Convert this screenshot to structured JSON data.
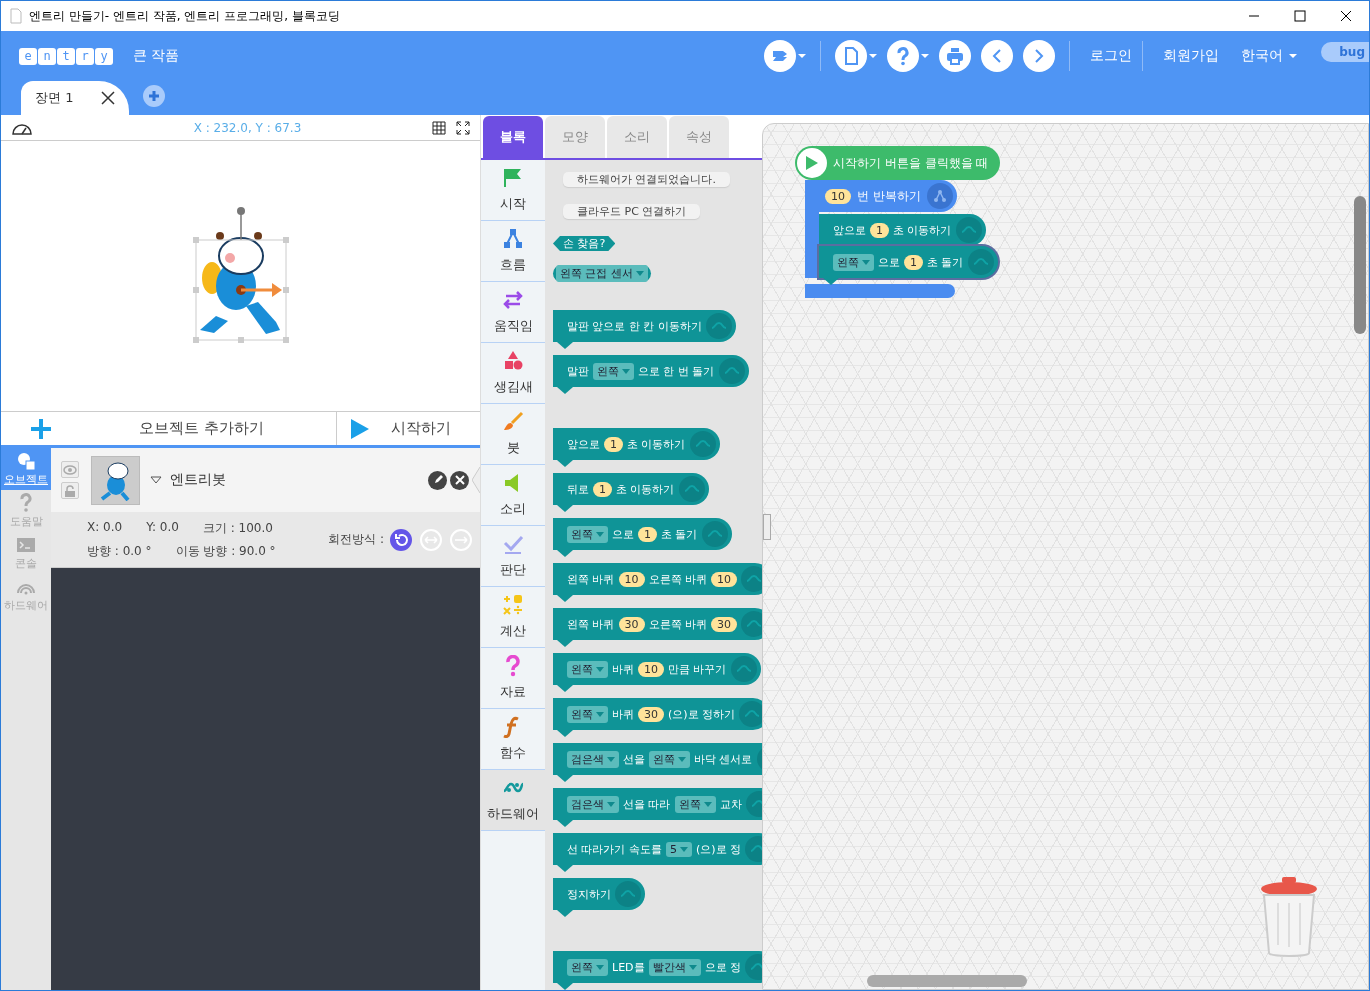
{
  "window": {
    "title": "엔트리 만들기- 엔트리 작품, 엔트리 프로그래밍, 블록코딩"
  },
  "header": {
    "logo_letters": [
      "e",
      "n",
      "t",
      "r",
      "y"
    ],
    "project_title": "큰 작품",
    "links": [
      {
        "label": "로그인"
      },
      {
        "label": "회원가입"
      }
    ],
    "language": "한국어",
    "bug_label": "bug"
  },
  "scene_tabs": [
    {
      "label": "장면 1",
      "selected": true
    }
  ],
  "stage": {
    "coordinates": "X : 232.0, Y : 67.3"
  },
  "stage_buttons": [
    {
      "kind": "add",
      "label": "오브젝트 추가하기"
    },
    {
      "kind": "start",
      "label": "시작하기"
    }
  ],
  "side_tabs": [
    {
      "kind": "object",
      "label": "오브젝트",
      "selected": true
    },
    {
      "kind": "help",
      "label": "도움말",
      "selected": false
    },
    {
      "kind": "console",
      "label": "콘솔",
      "selected": false
    },
    {
      "kind": "hardware",
      "label": "하드웨어",
      "selected": false
    }
  ],
  "object": {
    "name": "엔트리봇",
    "props_row1": [
      "X: 0.0",
      "Y: 0.0",
      "크기 : 100.0"
    ],
    "props_row2": [
      "방향 : 0.0 °",
      "이동 방향 : 90.0 °"
    ],
    "rotation_label": "회전방식 :",
    "rotation_modes": [
      {
        "kind": "free",
        "selected": true
      },
      {
        "kind": "horizontal",
        "selected": false
      },
      {
        "kind": "none",
        "selected": false
      }
    ]
  },
  "palette_tabs": [
    {
      "label": "블록",
      "selected": true
    },
    {
      "label": "모양",
      "selected": false
    },
    {
      "label": "소리",
      "selected": false
    },
    {
      "label": "속성",
      "selected": false
    }
  ],
  "categories": [
    {
      "kind": "start",
      "label": "시작",
      "selected": false
    },
    {
      "kind": "flow",
      "label": "흐름",
      "selected": false
    },
    {
      "kind": "move",
      "label": "움직임",
      "selected": false
    },
    {
      "kind": "looks",
      "label": "생김새",
      "selected": false
    },
    {
      "kind": "brush",
      "label": "붓",
      "selected": false
    },
    {
      "kind": "sound",
      "label": "소리",
      "selected": false
    },
    {
      "kind": "judge",
      "label": "판단",
      "selected": false
    },
    {
      "kind": "calc",
      "label": "계산",
      "selected": false
    },
    {
      "kind": "data",
      "label": "자료",
      "selected": false
    },
    {
      "kind": "func",
      "label": "함수",
      "selected": false
    },
    {
      "kind": "hardware",
      "label": "하드웨어",
      "selected": true
    }
  ],
  "palette": [
    {
      "kind": "button",
      "parts": [
        {
          "kind": "text",
          "text": "하드웨어가 연결되었습니다."
        }
      ]
    },
    {
      "kind": "button",
      "parts": [
        {
          "kind": "text",
          "text": "클라우드 PC 연결하기"
        }
      ]
    },
    {
      "kind": "boolean",
      "parts": [
        {
          "kind": "text",
          "text": "손 찾음?"
        }
      ]
    },
    {
      "kind": "value",
      "parts": [
        {
          "kind": "dropdown",
          "text": "왼쪽 근접 센서"
        }
      ]
    },
    {
      "kind": "divider"
    },
    {
      "kind": "command",
      "parts": [
        {
          "kind": "text",
          "text": "말판 앞으로 한 칸 이동하기"
        }
      ]
    },
    {
      "kind": "command",
      "parts": [
        {
          "kind": "text",
          "text": "말판"
        },
        {
          "kind": "dropdown",
          "text": "왼쪽"
        },
        {
          "kind": "text",
          "text": "으로 한 번 돌기"
        }
      ]
    },
    {
      "kind": "divider"
    },
    {
      "kind": "command",
      "parts": [
        {
          "kind": "text",
          "text": "앞으로"
        },
        {
          "kind": "number",
          "text": "1"
        },
        {
          "kind": "text",
          "text": "초 이동하기"
        }
      ]
    },
    {
      "kind": "command",
      "parts": [
        {
          "kind": "text",
          "text": "뒤로"
        },
        {
          "kind": "number",
          "text": "1"
        },
        {
          "kind": "text",
          "text": "초 이동하기"
        }
      ]
    },
    {
      "kind": "command",
      "parts": [
        {
          "kind": "dropdown",
          "text": "왼쪽"
        },
        {
          "kind": "text",
          "text": "으로"
        },
        {
          "kind": "number",
          "text": "1"
        },
        {
          "kind": "text",
          "text": "초 돌기"
        }
      ]
    },
    {
      "kind": "command",
      "parts": [
        {
          "kind": "text",
          "text": "왼쪽 바퀴"
        },
        {
          "kind": "number",
          "text": "10"
        },
        {
          "kind": "text",
          "text": "오른쪽 바퀴"
        },
        {
          "kind": "number",
          "text": "10"
        }
      ]
    },
    {
      "kind": "command",
      "parts": [
        {
          "kind": "text",
          "text": "왼쪽 바퀴"
        },
        {
          "kind": "number",
          "text": "30"
        },
        {
          "kind": "text",
          "text": "오른쪽 바퀴"
        },
        {
          "kind": "number",
          "text": "30"
        }
      ]
    },
    {
      "kind": "command",
      "parts": [
        {
          "kind": "dropdown",
          "text": "왼쪽"
        },
        {
          "kind": "text",
          "text": "바퀴"
        },
        {
          "kind": "number",
          "text": "10"
        },
        {
          "kind": "text",
          "text": "만큼 바꾸기"
        }
      ]
    },
    {
      "kind": "command",
      "parts": [
        {
          "kind": "dropdown",
          "text": "왼쪽"
        },
        {
          "kind": "text",
          "text": "바퀴"
        },
        {
          "kind": "number",
          "text": "30"
        },
        {
          "kind": "text",
          "text": "(으)로 정하기"
        }
      ]
    },
    {
      "kind": "command",
      "parts": [
        {
          "kind": "dropdown",
          "text": "검은색"
        },
        {
          "kind": "text",
          "text": "선을"
        },
        {
          "kind": "dropdown",
          "text": "왼쪽"
        },
        {
          "kind": "text",
          "text": "바닥 센서로"
        }
      ]
    },
    {
      "kind": "command",
      "parts": [
        {
          "kind": "dropdown",
          "text": "검은색"
        },
        {
          "kind": "text",
          "text": "선을 따라"
        },
        {
          "kind": "dropdown",
          "text": "왼쪽"
        },
        {
          "kind": "text",
          "text": "교차"
        }
      ]
    },
    {
      "kind": "command",
      "parts": [
        {
          "kind": "text",
          "text": "선 따라가기 속도를"
        },
        {
          "kind": "dropdown",
          "text": "5"
        },
        {
          "kind": "text",
          "text": "(으)로 정"
        }
      ]
    },
    {
      "kind": "command",
      "parts": [
        {
          "kind": "text",
          "text": "정지하기"
        }
      ]
    },
    {
      "kind": "divider"
    },
    {
      "kind": "command",
      "parts": [
        {
          "kind": "dropdown",
          "text": "왼쪽"
        },
        {
          "kind": "text",
          "text": "LED를"
        },
        {
          "kind": "dropdown",
          "text": "빨간색"
        },
        {
          "kind": "text",
          "text": "으로 정"
        }
      ]
    }
  ],
  "script": [
    {
      "kind": "event",
      "parts": [
        {
          "kind": "text",
          "text": "시작하기 버튼을 클릭했을 때"
        }
      ]
    },
    {
      "kind": "loop",
      "parts": [
        {
          "kind": "number",
          "text": "10"
        },
        {
          "kind": "text",
          "text": "번 반복하기"
        }
      ],
      "children": [
        {
          "kind": "command",
          "selected": false,
          "parts": [
            {
              "kind": "text",
              "text": "앞으로"
            },
            {
              "kind": "number",
              "text": "1"
            },
            {
              "kind": "text",
              "text": "초 이동하기"
            }
          ]
        },
        {
          "kind": "command",
          "selected": true,
          "parts": [
            {
              "kind": "dropdown",
              "text": "왼쪽"
            },
            {
              "kind": "text",
              "text": "으로"
            },
            {
              "kind": "number",
              "text": "1"
            },
            {
              "kind": "text",
              "text": "초 돌기"
            }
          ]
        }
      ]
    }
  ]
}
